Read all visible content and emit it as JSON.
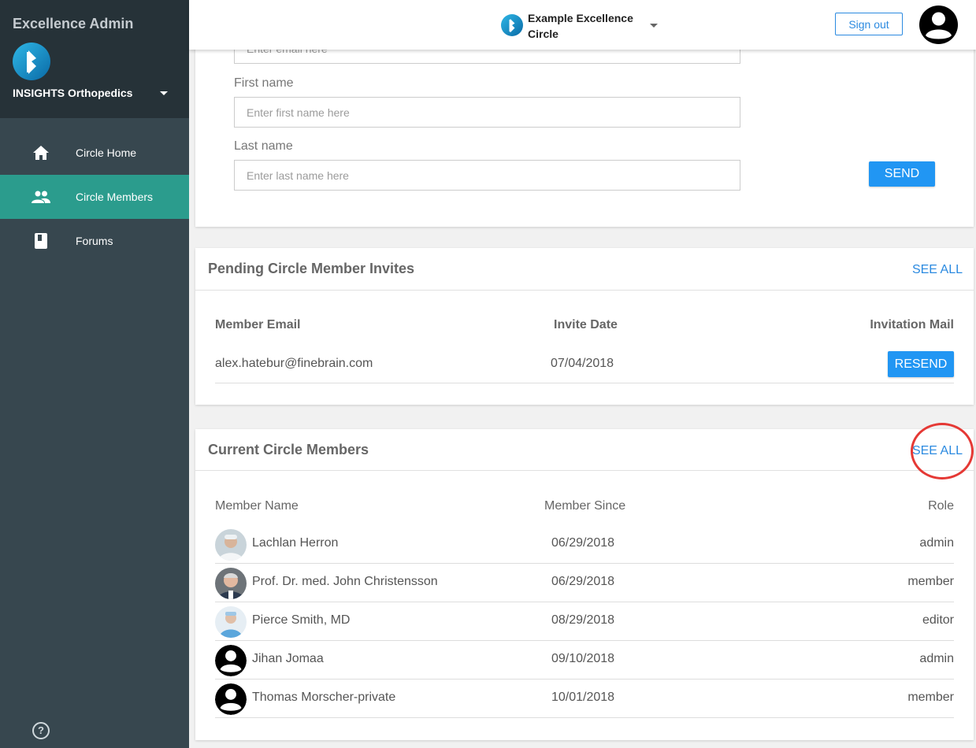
{
  "sidebar": {
    "app_title": "Excellence Admin",
    "org_name": "INSIGHTS Orthopedics",
    "items": [
      {
        "label": "Circle Home",
        "icon": "home-icon",
        "active": false
      },
      {
        "label": "Circle Members",
        "icon": "people-icon",
        "active": true
      },
      {
        "label": "Forums",
        "icon": "book-icon",
        "active": false
      }
    ],
    "help_icon": "?"
  },
  "topbar": {
    "circle_name": "Example Excellence Circle",
    "sign_out_label": "Sign out"
  },
  "invite_form": {
    "email_placeholder": "Enter email here",
    "first_name_label": "First name",
    "first_name_placeholder": "Enter first name here",
    "last_name_label": "Last name",
    "last_name_placeholder": "Enter last name here",
    "send_label": "SEND"
  },
  "pending": {
    "title": "Pending Circle Member Invites",
    "see_all": "SEE ALL",
    "columns": [
      "Member Email",
      "Invite Date",
      "Invitation Mail"
    ],
    "rows": [
      {
        "email": "alex.hatebur@finebrain.com",
        "date": "07/04/2018",
        "action": "RESEND"
      }
    ]
  },
  "current": {
    "title": "Current Circle Members",
    "see_all": "SEE ALL",
    "columns": [
      "Member Name",
      "Member Since",
      "Role"
    ],
    "rows": [
      {
        "name": "Lachlan Herron",
        "since": "06/29/2018",
        "role": "admin",
        "avatar": "photo"
      },
      {
        "name": "Prof. Dr. med. John Christensson",
        "since": "06/29/2018",
        "role": "member",
        "avatar": "photo"
      },
      {
        "name": "Pierce Smith, MD",
        "since": "08/29/2018",
        "role": "editor",
        "avatar": "photo"
      },
      {
        "name": "Jihan Jomaa",
        "since": "09/10/2018",
        "role": "admin",
        "avatar": "default"
      },
      {
        "name": "Thomas Morscher-private",
        "since": "10/01/2018",
        "role": "member",
        "avatar": "default"
      }
    ]
  },
  "colors": {
    "sidebar_bg": "#37474f",
    "sidebar_head_bg": "#263238",
    "active_nav": "#2b9c8d",
    "accent_blue": "#2196f3",
    "highlight_red": "#e53935"
  }
}
